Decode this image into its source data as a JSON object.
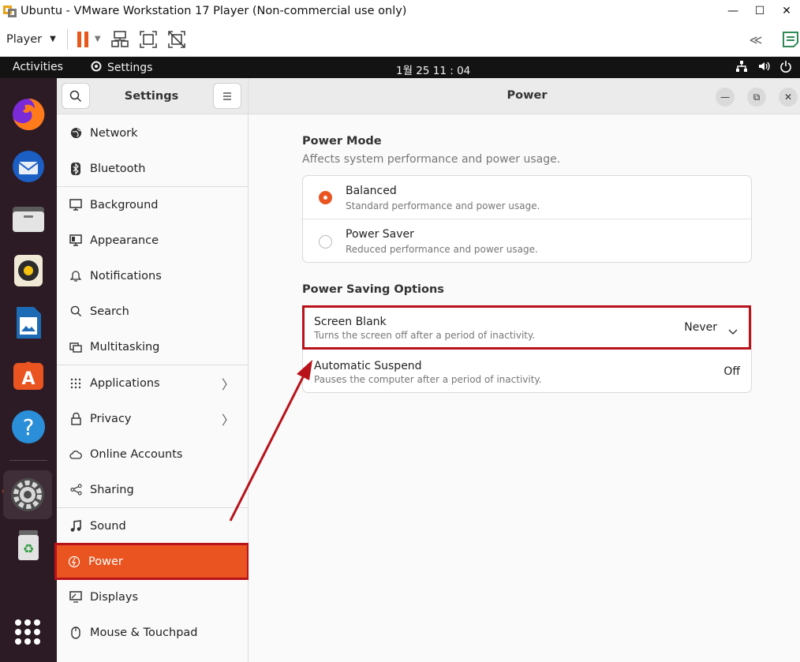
{
  "window": {
    "title": "Ubuntu - VMware Workstation 17 Player (Non-commercial use only)",
    "controls": [
      "—",
      "☐",
      "✕"
    ]
  },
  "vm_toolbar": {
    "player_label": "Player",
    "icons": [
      "pause-icon",
      "send-ctrl-alt-del-icon",
      "fit-guest-icon",
      "unity-icon",
      "collapse-icon",
      "notes-icon"
    ]
  },
  "gnome_bar": {
    "activities": "Activities",
    "app_name": "Settings",
    "clock": "1월 25  11 : 04"
  },
  "dock": {
    "apps": [
      "Firefox",
      "Thunderbird",
      "Files",
      "Rhythmbox",
      "LibreOffice Writer",
      "Ubuntu Software",
      "Help",
      "Settings",
      "Trash",
      "Show Applications"
    ]
  },
  "sidebar": {
    "title": "Settings",
    "items": [
      {
        "label": "Network",
        "icon": "globe-icon"
      },
      {
        "label": "Bluetooth",
        "icon": "bluetooth-icon"
      },
      {
        "label": "Background",
        "icon": "monitor-icon"
      },
      {
        "label": "Appearance",
        "icon": "appearance-icon"
      },
      {
        "label": "Notifications",
        "icon": "bell-icon"
      },
      {
        "label": "Search",
        "icon": "search-icon"
      },
      {
        "label": "Multitasking",
        "icon": "multitasking-icon"
      },
      {
        "label": "Applications",
        "icon": "grid-icon"
      },
      {
        "label": "Privacy",
        "icon": "lock-icon"
      },
      {
        "label": "Online Accounts",
        "icon": "cloud-icon"
      },
      {
        "label": "Sharing",
        "icon": "share-icon"
      },
      {
        "label": "Sound",
        "icon": "music-icon"
      },
      {
        "label": "Power",
        "icon": "power-icon"
      },
      {
        "label": "Displays",
        "icon": "display-icon"
      },
      {
        "label": "Mouse & Touchpad",
        "icon": "mouse-icon"
      }
    ]
  },
  "content": {
    "title": "Power",
    "power_mode": {
      "title": "Power Mode",
      "subtitle": "Affects system performance and power usage.",
      "options": [
        {
          "label": "Balanced",
          "desc": "Standard performance and power usage.",
          "selected": true
        },
        {
          "label": "Power Saver",
          "desc": "Reduced performance and power usage.",
          "selected": false
        }
      ]
    },
    "saving": {
      "title": "Power Saving Options",
      "screen_blank": {
        "label": "Screen Blank",
        "desc": "Turns the screen off after a period of inactivity.",
        "value": "Never"
      },
      "auto_suspend": {
        "label": "Automatic Suspend",
        "desc": "Pauses the computer after a period of inactivity.",
        "value": "Off"
      }
    }
  },
  "colors": {
    "accent": "#e95420",
    "highlight": "#b8121a"
  }
}
